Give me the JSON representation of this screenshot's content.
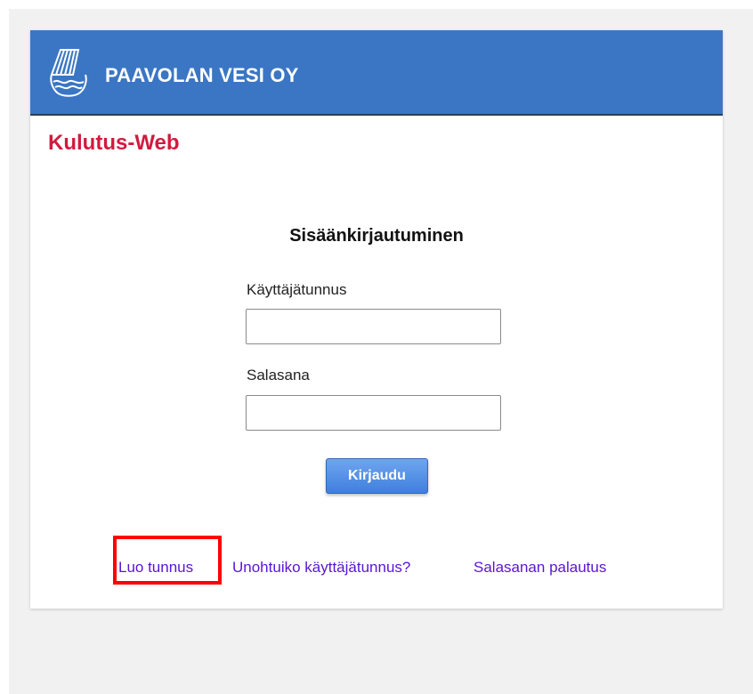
{
  "header": {
    "company_name": "PAAVOLAN VESI OY",
    "logo_icon": "waterfall-logo-icon",
    "background_color": "#3b76c4"
  },
  "app": {
    "title": "Kulutus-Web",
    "title_color": "#d3193f"
  },
  "login": {
    "title": "Sisäänkirjautuminen",
    "username_label": "Käyttäjätunnus",
    "username_value": "",
    "password_label": "Salasana",
    "password_value": "",
    "submit_label": "Kirjaudu"
  },
  "links": {
    "create_account": "Luo tunnus",
    "forgot_username": "Unohtuiko käyttäjätunnus?",
    "password_reset": "Salasanan palautus",
    "link_color": "#5a14d6"
  },
  "highlight": {
    "target": "Luo tunnus",
    "color": "#ff0000"
  }
}
